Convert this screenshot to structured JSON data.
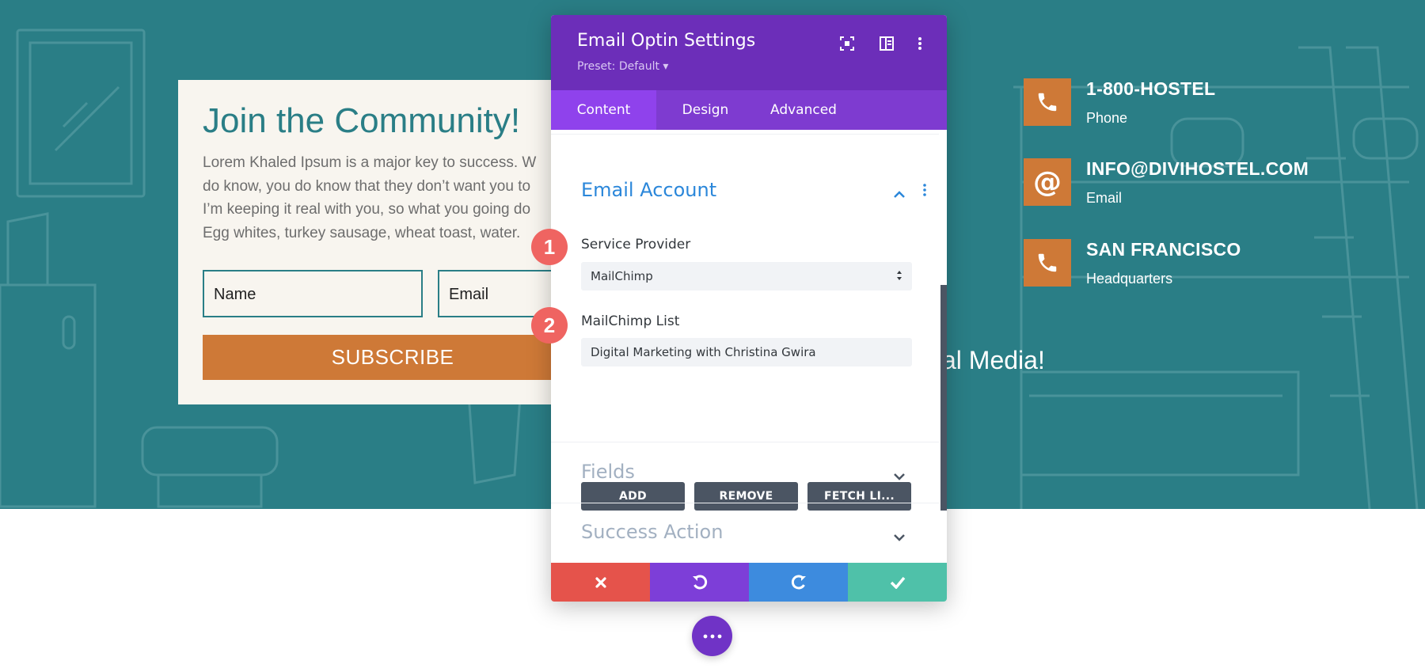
{
  "colors": {
    "teal": "#2a7e86",
    "orange": "#ce7937",
    "purple_header": "#6c2eb9",
    "purple_tabs": "#7e3bd0",
    "tab_active": "#8f42ec",
    "blue_accent": "#2b87da",
    "badge_red": "#ef6461",
    "cancel": "#e5534b",
    "undo": "#7d3ed8",
    "redo": "#3d8bde",
    "save": "#4fc1a9"
  },
  "optin": {
    "title": "Join the Community!",
    "description_lines": [
      "Lorem Khaled Ipsum is a major key to success. W",
      "do know, you do know that they don’t want you to",
      "I’m keeping it real with you, so what you going do",
      "Egg whites, turkey sausage, wheat toast, water."
    ],
    "name_placeholder": "Name",
    "email_placeholder": "Email",
    "subscribe_label": "SUBSCRIBE"
  },
  "contacts": [
    {
      "title": "1-800-HOSTEL",
      "subtitle": "Phone",
      "icon": "phone-icon"
    },
    {
      "title": "INFO@DIVIHOSTEL.COM",
      "subtitle": "Email",
      "icon": "at-icon"
    },
    {
      "title": "SAN FRANCISCO",
      "subtitle": "Headquarters",
      "icon": "phone-icon"
    }
  ],
  "social_text": "al Media!",
  "panel": {
    "title": "Email Optin Settings",
    "preset": "Preset: Default ▾",
    "header_icons": [
      "fullscreen-icon",
      "split-view-icon",
      "more-vertical-icon"
    ],
    "tabs": [
      {
        "label": "Content",
        "active": true
      },
      {
        "label": "Design",
        "active": false
      },
      {
        "label": "Advanced",
        "active": false
      }
    ],
    "email_account": {
      "title": "Email Account",
      "service_provider_label": "Service Provider",
      "service_provider_value": "MailChimp",
      "list_label": "MailChimp List",
      "list_value": "Digital Marketing with Christina Gwira",
      "buttons": [
        "ADD",
        "REMOVE",
        "FETCH LI..."
      ]
    },
    "sections": [
      "Fields",
      "Success Action"
    ],
    "footer": [
      "cancel-icon",
      "undo-icon",
      "redo-icon",
      "save-check-icon"
    ]
  },
  "badges": [
    "1",
    "2"
  ]
}
